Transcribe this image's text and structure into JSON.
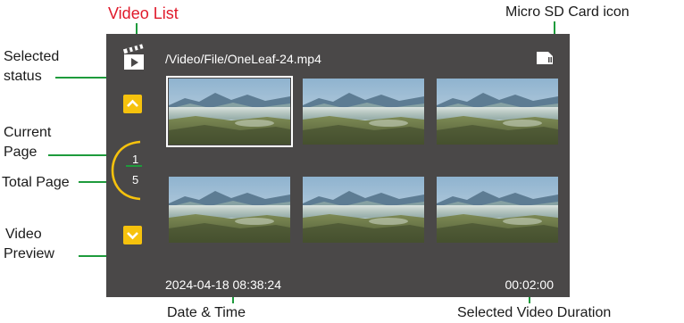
{
  "callouts": {
    "video_list": "Video List",
    "sd_icon": "Micro SD Card icon",
    "selected_status_1": "Selected",
    "selected_status_2": "status",
    "current_page_1": "Current",
    "current_page_2": "Page",
    "total_page": "Total Page",
    "video_preview_1": "Video",
    "video_preview_2": "Preview",
    "date_time": "Date & Time",
    "selected_duration": "Selected Video Duration"
  },
  "screen": {
    "file_path": "/Video/File/OneLeaf-24.mp4",
    "current_page": "1",
    "total_pages": "5",
    "datetime": "2024-04-18 08:38:24",
    "duration": "00:02:00",
    "thumbnails": [
      {
        "selected": true
      },
      {
        "selected": false
      },
      {
        "selected": false
      },
      {
        "selected": false
      },
      {
        "selected": false
      },
      {
        "selected": false
      }
    ]
  },
  "icons": {
    "video_list": "clapperboard-icon",
    "sd_card": "sd-card-icon",
    "page_up": "chevron-up-icon",
    "page_down": "chevron-down-icon"
  },
  "colors": {
    "screen_bg": "#4a4848",
    "accent": "#f6c20d",
    "leader": "#1e9b3c",
    "label_red": "#e0192a"
  }
}
